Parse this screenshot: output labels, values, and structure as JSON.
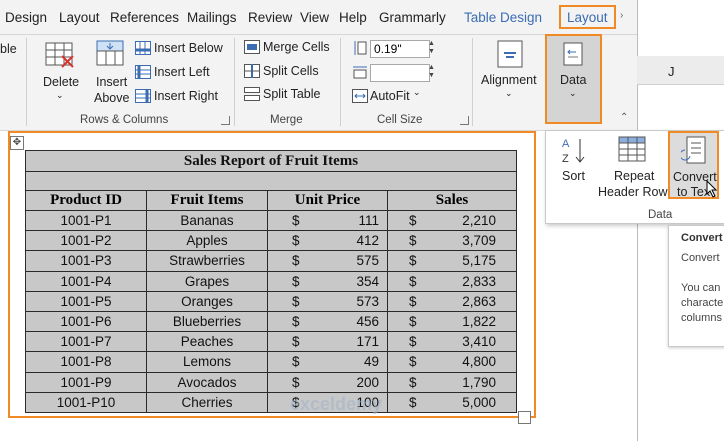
{
  "tabs": [
    {
      "label": "Design",
      "selected": false
    },
    {
      "label": "Layout",
      "selected": false
    },
    {
      "label": "References",
      "selected": false
    },
    {
      "label": "Mailings",
      "selected": false
    },
    {
      "label": "Review",
      "selected": false
    },
    {
      "label": "View",
      "selected": false
    },
    {
      "label": "Help",
      "selected": false
    },
    {
      "label": "Grammarly",
      "selected": false
    },
    {
      "label": "Table Design",
      "selected": true
    },
    {
      "label": "Layout",
      "selected": true,
      "highlighted": true
    }
  ],
  "ribbon": {
    "partial_left_label": "ble",
    "rows_columns": {
      "delete_label": "Delete",
      "insert_above_line1": "Insert",
      "insert_above_line2": "Above",
      "insert_below": "Insert Below",
      "insert_left": "Insert Left",
      "insert_right": "Insert Right",
      "group_label": "Rows & Columns"
    },
    "merge": {
      "merge_cells": "Merge Cells",
      "split_cells": "Split Cells",
      "split_table": "Split Table",
      "group_label": "Merge"
    },
    "cell_size": {
      "height_value": "0.19\"",
      "width_value": "",
      "autofit": "AutoFit",
      "group_label": "Cell Size"
    },
    "alignment_label": "Alignment",
    "data_label": "Data"
  },
  "data_menu": {
    "sort": "Sort",
    "repeat_line1": "Repeat",
    "repeat_line2": "Header Rows",
    "convert_line1": "Convert",
    "convert_line2": "to Tex",
    "group_label": "Data"
  },
  "tooltip": {
    "title": "Convert",
    "line1": "Convert",
    "line2": "You can",
    "line3": "characte",
    "line4": "columns"
  },
  "sheet": {
    "column_letter": "J"
  },
  "table": {
    "title": "Sales Report of Fruit Items",
    "headers": [
      "Product ID",
      "Fruit Items",
      "Unit Price",
      "Sales"
    ],
    "currency": "$",
    "rows": [
      [
        "1001-P1",
        "Bananas",
        "111",
        "2,210"
      ],
      [
        "1001-P2",
        "Apples",
        "412",
        "3,709"
      ],
      [
        "1001-P3",
        "Strawberries",
        "575",
        "5,175"
      ],
      [
        "1001-P4",
        "Grapes",
        "354",
        "2,833"
      ],
      [
        "1001-P5",
        "Oranges",
        "573",
        "2,863"
      ],
      [
        "1001-P6",
        "Blueberries",
        "456",
        "1,822"
      ],
      [
        "1001-P7",
        "Peaches",
        "171",
        "3,410"
      ],
      [
        "1001-P8",
        "Lemons",
        "49",
        "4,800"
      ],
      [
        "1001-P9",
        "Avocados",
        "200",
        "1,790"
      ],
      [
        "1001-P10",
        "Cherries",
        "100",
        "5,000"
      ]
    ]
  },
  "watermark": {
    "name": "exceldemy",
    "tagline": "EXCEL · DATA · BI"
  },
  "colors": {
    "highlight": "#f08a24",
    "accent": "#3b6db3",
    "table_fill": "#c8c8c8"
  }
}
